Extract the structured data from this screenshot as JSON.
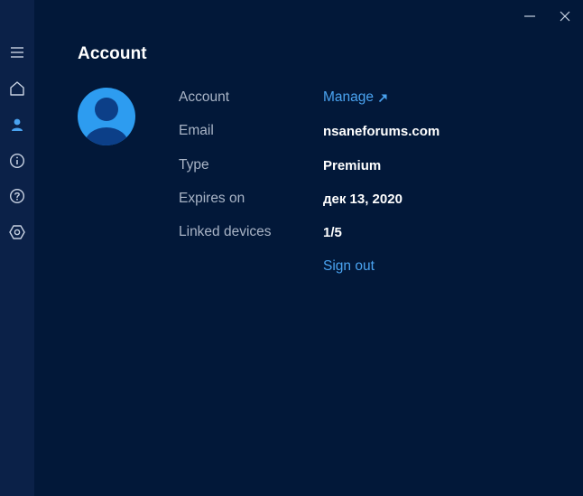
{
  "colors": {
    "background": "#021839",
    "sidebar": "#0b2148",
    "accent": "#4aa3f0",
    "label": "#a9b4c6",
    "icon": "#c9d3e3",
    "active_icon": "#4aa3f0"
  },
  "sidebar": {
    "items": [
      {
        "icon": "hamburger-menu-icon"
      },
      {
        "icon": "home-icon"
      },
      {
        "icon": "account-icon",
        "active": true
      },
      {
        "icon": "info-icon"
      },
      {
        "icon": "help-icon"
      },
      {
        "icon": "settings-icon"
      }
    ]
  },
  "window_controls": {
    "minimize": "minimize-icon",
    "close": "close-icon"
  },
  "page": {
    "title": "Account"
  },
  "account": {
    "rows": [
      {
        "label": "Account",
        "value": "Manage",
        "type": "link",
        "icon": "external-link-icon"
      },
      {
        "label": "Email",
        "value": "nsaneforums.com",
        "type": "text"
      },
      {
        "label": "Type",
        "value": "Premium",
        "type": "text"
      },
      {
        "label": "Expires on",
        "value": "дек 13, 2020",
        "type": "text"
      },
      {
        "label": "Linked devices",
        "value": "1/5",
        "type": "text"
      }
    ],
    "sign_out_label": "Sign out"
  }
}
